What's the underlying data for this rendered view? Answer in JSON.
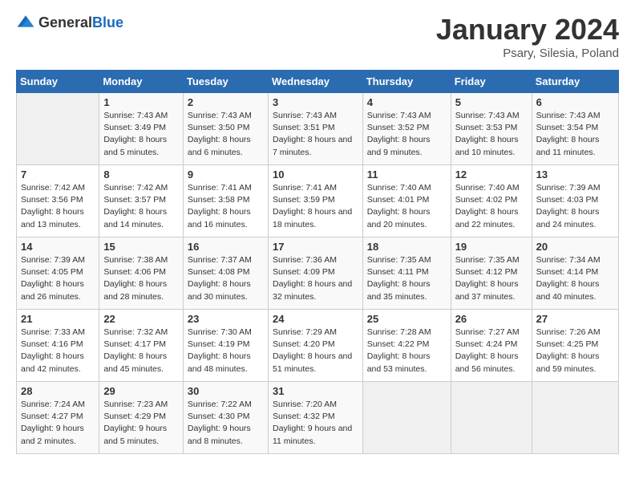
{
  "logo": {
    "general": "General",
    "blue": "Blue"
  },
  "title": "January 2024",
  "subtitle": "Psary, Silesia, Poland",
  "weekdays": [
    "Sunday",
    "Monday",
    "Tuesday",
    "Wednesday",
    "Thursday",
    "Friday",
    "Saturday"
  ],
  "weeks": [
    [
      {
        "day": "",
        "sunrise": "",
        "sunset": "",
        "daylight": ""
      },
      {
        "day": "1",
        "sunrise": "Sunrise: 7:43 AM",
        "sunset": "Sunset: 3:49 PM",
        "daylight": "Daylight: 8 hours and 5 minutes."
      },
      {
        "day": "2",
        "sunrise": "Sunrise: 7:43 AM",
        "sunset": "Sunset: 3:50 PM",
        "daylight": "Daylight: 8 hours and 6 minutes."
      },
      {
        "day": "3",
        "sunrise": "Sunrise: 7:43 AM",
        "sunset": "Sunset: 3:51 PM",
        "daylight": "Daylight: 8 hours and 7 minutes."
      },
      {
        "day": "4",
        "sunrise": "Sunrise: 7:43 AM",
        "sunset": "Sunset: 3:52 PM",
        "daylight": "Daylight: 8 hours and 9 minutes."
      },
      {
        "day": "5",
        "sunrise": "Sunrise: 7:43 AM",
        "sunset": "Sunset: 3:53 PM",
        "daylight": "Daylight: 8 hours and 10 minutes."
      },
      {
        "day": "6",
        "sunrise": "Sunrise: 7:43 AM",
        "sunset": "Sunset: 3:54 PM",
        "daylight": "Daylight: 8 hours and 11 minutes."
      }
    ],
    [
      {
        "day": "7",
        "sunrise": "Sunrise: 7:42 AM",
        "sunset": "Sunset: 3:56 PM",
        "daylight": "Daylight: 8 hours and 13 minutes."
      },
      {
        "day": "8",
        "sunrise": "Sunrise: 7:42 AM",
        "sunset": "Sunset: 3:57 PM",
        "daylight": "Daylight: 8 hours and 14 minutes."
      },
      {
        "day": "9",
        "sunrise": "Sunrise: 7:41 AM",
        "sunset": "Sunset: 3:58 PM",
        "daylight": "Daylight: 8 hours and 16 minutes."
      },
      {
        "day": "10",
        "sunrise": "Sunrise: 7:41 AM",
        "sunset": "Sunset: 3:59 PM",
        "daylight": "Daylight: 8 hours and 18 minutes."
      },
      {
        "day": "11",
        "sunrise": "Sunrise: 7:40 AM",
        "sunset": "Sunset: 4:01 PM",
        "daylight": "Daylight: 8 hours and 20 minutes."
      },
      {
        "day": "12",
        "sunrise": "Sunrise: 7:40 AM",
        "sunset": "Sunset: 4:02 PM",
        "daylight": "Daylight: 8 hours and 22 minutes."
      },
      {
        "day": "13",
        "sunrise": "Sunrise: 7:39 AM",
        "sunset": "Sunset: 4:03 PM",
        "daylight": "Daylight: 8 hours and 24 minutes."
      }
    ],
    [
      {
        "day": "14",
        "sunrise": "Sunrise: 7:39 AM",
        "sunset": "Sunset: 4:05 PM",
        "daylight": "Daylight: 8 hours and 26 minutes."
      },
      {
        "day": "15",
        "sunrise": "Sunrise: 7:38 AM",
        "sunset": "Sunset: 4:06 PM",
        "daylight": "Daylight: 8 hours and 28 minutes."
      },
      {
        "day": "16",
        "sunrise": "Sunrise: 7:37 AM",
        "sunset": "Sunset: 4:08 PM",
        "daylight": "Daylight: 8 hours and 30 minutes."
      },
      {
        "day": "17",
        "sunrise": "Sunrise: 7:36 AM",
        "sunset": "Sunset: 4:09 PM",
        "daylight": "Daylight: 8 hours and 32 minutes."
      },
      {
        "day": "18",
        "sunrise": "Sunrise: 7:35 AM",
        "sunset": "Sunset: 4:11 PM",
        "daylight": "Daylight: 8 hours and 35 minutes."
      },
      {
        "day": "19",
        "sunrise": "Sunrise: 7:35 AM",
        "sunset": "Sunset: 4:12 PM",
        "daylight": "Daylight: 8 hours and 37 minutes."
      },
      {
        "day": "20",
        "sunrise": "Sunrise: 7:34 AM",
        "sunset": "Sunset: 4:14 PM",
        "daylight": "Daylight: 8 hours and 40 minutes."
      }
    ],
    [
      {
        "day": "21",
        "sunrise": "Sunrise: 7:33 AM",
        "sunset": "Sunset: 4:16 PM",
        "daylight": "Daylight: 8 hours and 42 minutes."
      },
      {
        "day": "22",
        "sunrise": "Sunrise: 7:32 AM",
        "sunset": "Sunset: 4:17 PM",
        "daylight": "Daylight: 8 hours and 45 minutes."
      },
      {
        "day": "23",
        "sunrise": "Sunrise: 7:30 AM",
        "sunset": "Sunset: 4:19 PM",
        "daylight": "Daylight: 8 hours and 48 minutes."
      },
      {
        "day": "24",
        "sunrise": "Sunrise: 7:29 AM",
        "sunset": "Sunset: 4:20 PM",
        "daylight": "Daylight: 8 hours and 51 minutes."
      },
      {
        "day": "25",
        "sunrise": "Sunrise: 7:28 AM",
        "sunset": "Sunset: 4:22 PM",
        "daylight": "Daylight: 8 hours and 53 minutes."
      },
      {
        "day": "26",
        "sunrise": "Sunrise: 7:27 AM",
        "sunset": "Sunset: 4:24 PM",
        "daylight": "Daylight: 8 hours and 56 minutes."
      },
      {
        "day": "27",
        "sunrise": "Sunrise: 7:26 AM",
        "sunset": "Sunset: 4:25 PM",
        "daylight": "Daylight: 8 hours and 59 minutes."
      }
    ],
    [
      {
        "day": "28",
        "sunrise": "Sunrise: 7:24 AM",
        "sunset": "Sunset: 4:27 PM",
        "daylight": "Daylight: 9 hours and 2 minutes."
      },
      {
        "day": "29",
        "sunrise": "Sunrise: 7:23 AM",
        "sunset": "Sunset: 4:29 PM",
        "daylight": "Daylight: 9 hours and 5 minutes."
      },
      {
        "day": "30",
        "sunrise": "Sunrise: 7:22 AM",
        "sunset": "Sunset: 4:30 PM",
        "daylight": "Daylight: 9 hours and 8 minutes."
      },
      {
        "day": "31",
        "sunrise": "Sunrise: 7:20 AM",
        "sunset": "Sunset: 4:32 PM",
        "daylight": "Daylight: 9 hours and 11 minutes."
      },
      {
        "day": "",
        "sunrise": "",
        "sunset": "",
        "daylight": ""
      },
      {
        "day": "",
        "sunrise": "",
        "sunset": "",
        "daylight": ""
      },
      {
        "day": "",
        "sunrise": "",
        "sunset": "",
        "daylight": ""
      }
    ]
  ]
}
